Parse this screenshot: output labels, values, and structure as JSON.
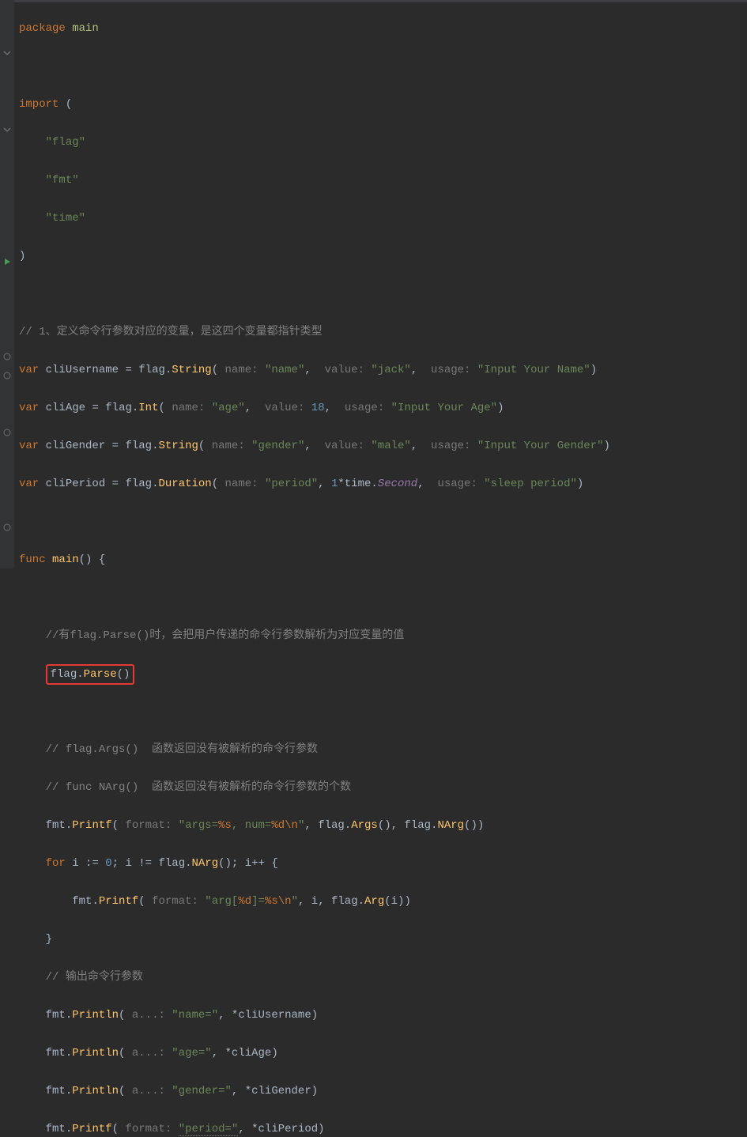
{
  "code": {
    "pkg_kw": "package",
    "pkg_name": "main",
    "import_kw": "import",
    "paren_open": "(",
    "paren_close": ")",
    "imp_flag": "\"flag\"",
    "imp_fmt": "\"fmt\"",
    "imp_time": "\"time\"",
    "c1": "// 1、定义命令行参数对应的变量，是这四个变量都指针类型",
    "var_kw": "var",
    "v1": "cliUsername",
    "v2": "cliAge",
    "v3": "cliGender",
    "v4": "cliPeriod",
    "eq": " = ",
    "flag_pkg": "flag",
    "dot": ".",
    "fn_string": "String",
    "fn_int": "Int",
    "fn_duration": "Duration",
    "hint_name": "name:",
    "hint_value": "value:",
    "hint_usage": "usage:",
    "s_name": "\"name\"",
    "s_jack": "\"jack\"",
    "s_iyn": "\"Input Your Name\"",
    "s_age": "\"age\"",
    "n_18": "18",
    "s_iya": "\"Input Your Age\"",
    "s_gender": "\"gender\"",
    "s_male": "\"male\"",
    "s_iyg": "\"Input Your Gender\"",
    "s_period": "\"period\"",
    "one": "1",
    "star": "*",
    "time_pkg": "time",
    "second_field": "Second",
    "s_sleep": "\"sleep period\"",
    "func_kw": "func",
    "main_fn": "main",
    "lbrace": "{",
    "rbrace": "}",
    "c_parse": "//有flag.Parse()时，会把用户传递的命令行参数解析为对应变量的值",
    "parse_call": "flag",
    "parse_fn": "Parse",
    "c_args": "// flag.Args()  函数返回没有被解析的命令行参数",
    "c_narg": "// func NArg()  函数返回没有被解析的命令行参数的个数",
    "fmt_pkg": "fmt",
    "printf_fn": "Printf",
    "println_fn": "Println",
    "hint_format": "format:",
    "hint_a": "a...:",
    "s_argsnum_1": "\"args=",
    "s_argsnum_pc_s": "%s",
    "s_argsnum_mid": ", num=",
    "s_argsnum_pc_d": "%d",
    "s_argsnum_nl": "\\n",
    "s_argsnum_end": "\"",
    "args_fn": "Args",
    "narg_fn": "NArg",
    "arg_fn": "Arg",
    "for_kw": "for",
    "i_ident": "i",
    "coloneq": " := ",
    "zero": "0",
    "semi": "; ",
    "ne": " != ",
    "pp": "++ ",
    "s_argfmt_1": "\"arg[",
    "s_argfmt_2": "]=",
    "c_out": "// 输出命令行参数",
    "s_nameeq": "\"name=\"",
    "s_ageeq": "\"age=\"",
    "s_gendereq": "\"gender=\"",
    "s_periodeq": "\"period=\"",
    "comma": ", ",
    "deref": "*"
  }
}
